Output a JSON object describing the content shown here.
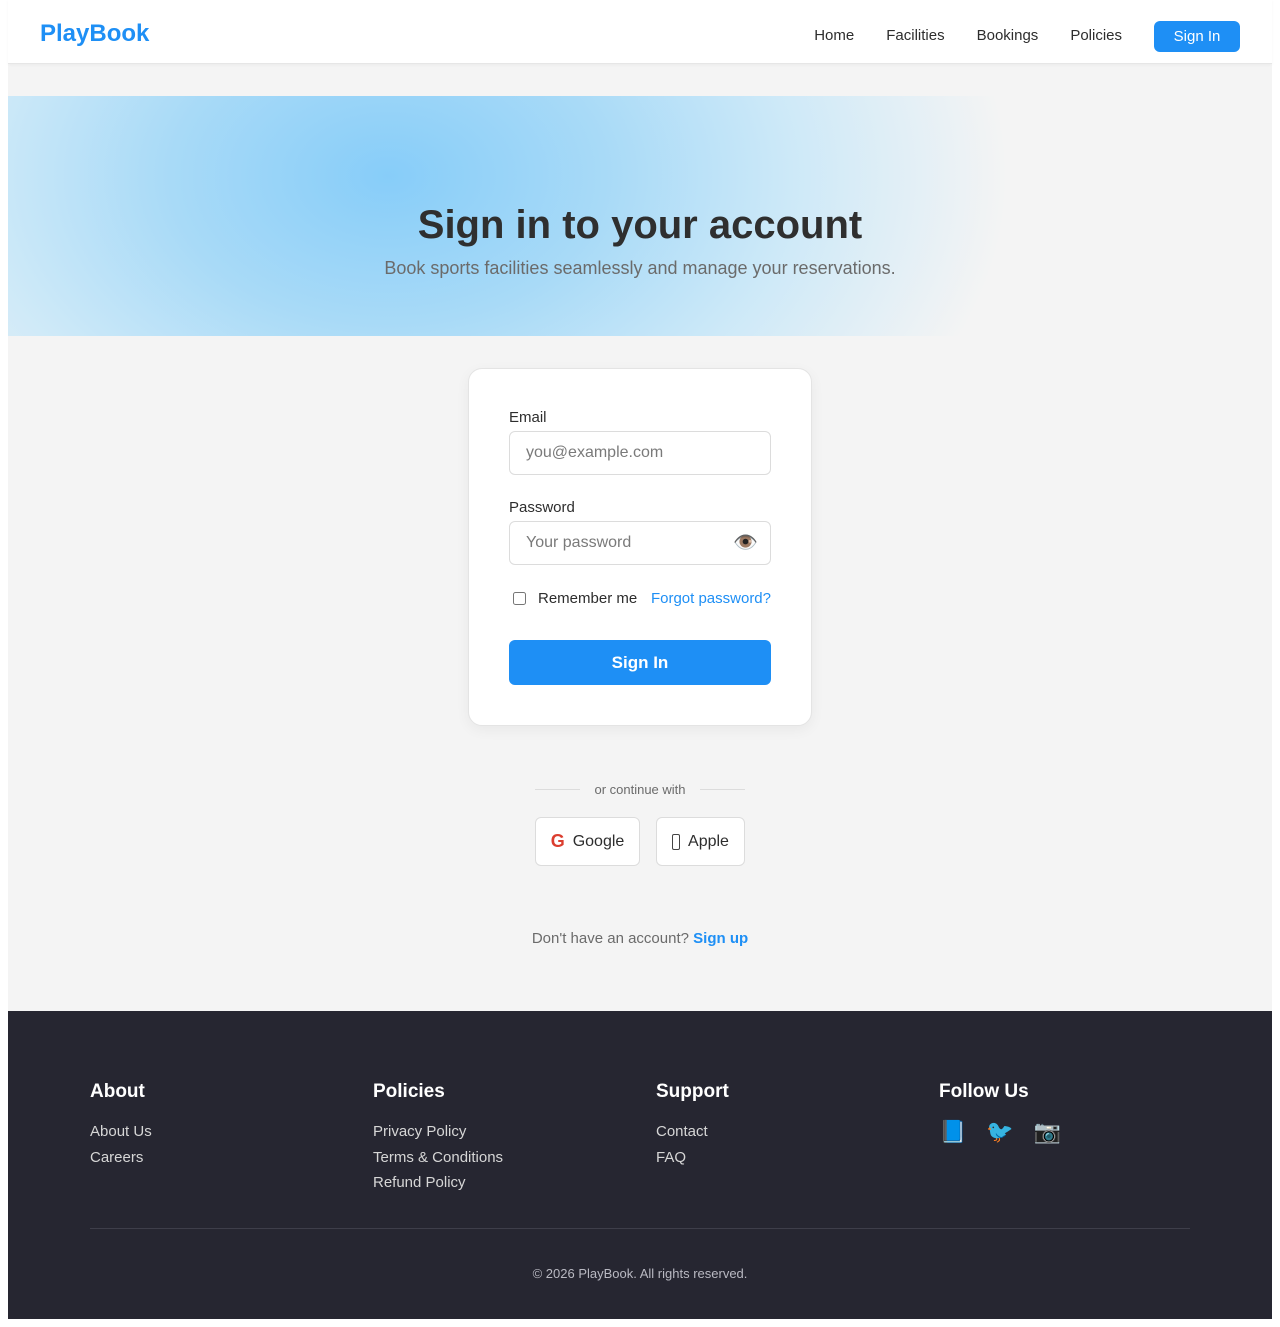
{
  "header": {
    "brand": "PlayBook",
    "nav": [
      "Home",
      "Facilities",
      "Bookings",
      "Policies"
    ],
    "signin_label": "Sign In"
  },
  "hero": {
    "title": "Sign in to your account",
    "subtitle": "Book sports facilities seamlessly and manage your reservations."
  },
  "form": {
    "email_label": "Email",
    "email_placeholder": "you@example.com",
    "password_label": "Password",
    "password_placeholder": "Your password",
    "password_toggle_icon": "eye-icon",
    "remember_label": "Remember me",
    "remember_checked": false,
    "forgot_label": "Forgot password?",
    "submit_label": "Sign In"
  },
  "social": {
    "divider_text": "or continue with",
    "google_label": "Google",
    "google_icon": "G",
    "apple_label": "Apple"
  },
  "signup": {
    "prompt": "Don't have an account?",
    "link": "Sign up"
  },
  "footer": {
    "about": {
      "title": "About",
      "links": [
        "About Us",
        "Careers"
      ]
    },
    "policies": {
      "title": "Policies",
      "links": [
        "Privacy Policy",
        "Terms & Conditions",
        "Refund Policy"
      ]
    },
    "support": {
      "title": "Support",
      "links": [
        "Contact",
        "FAQ"
      ]
    },
    "follow": {
      "title": "Follow Us",
      "icons": [
        "📘",
        "🐦",
        "📷"
      ]
    },
    "copyright": "© 2026 PlayBook. All rights reserved."
  },
  "colors": {
    "accent": "#1e8ff5",
    "footer_bg": "#262631",
    "page_bg": "#f4f4f4"
  }
}
